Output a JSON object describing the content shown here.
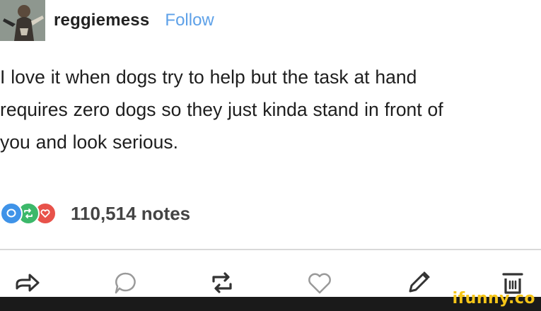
{
  "header": {
    "username": "reggiemess",
    "follow_label": "Follow"
  },
  "post": {
    "text": "I love it when dogs try to help but the task at hand\nrequires zero dogs so they just kinda stand in front of\nyou and look serious."
  },
  "notes": {
    "count_label": "110,514 notes",
    "icons": [
      "reply-icon",
      "reblog-icon",
      "like-icon"
    ]
  },
  "actions": [
    "share-icon",
    "reply-icon",
    "reblog-icon",
    "like-icon",
    "edit-icon",
    "delete-icon"
  ],
  "watermark": {
    "text": "ifunny.co"
  },
  "colors": {
    "follow": "#5ea1e8",
    "reply": "#3f93e8",
    "reblog": "#3cb86a",
    "like": "#e8524a",
    "watermark": "#f5c518"
  }
}
